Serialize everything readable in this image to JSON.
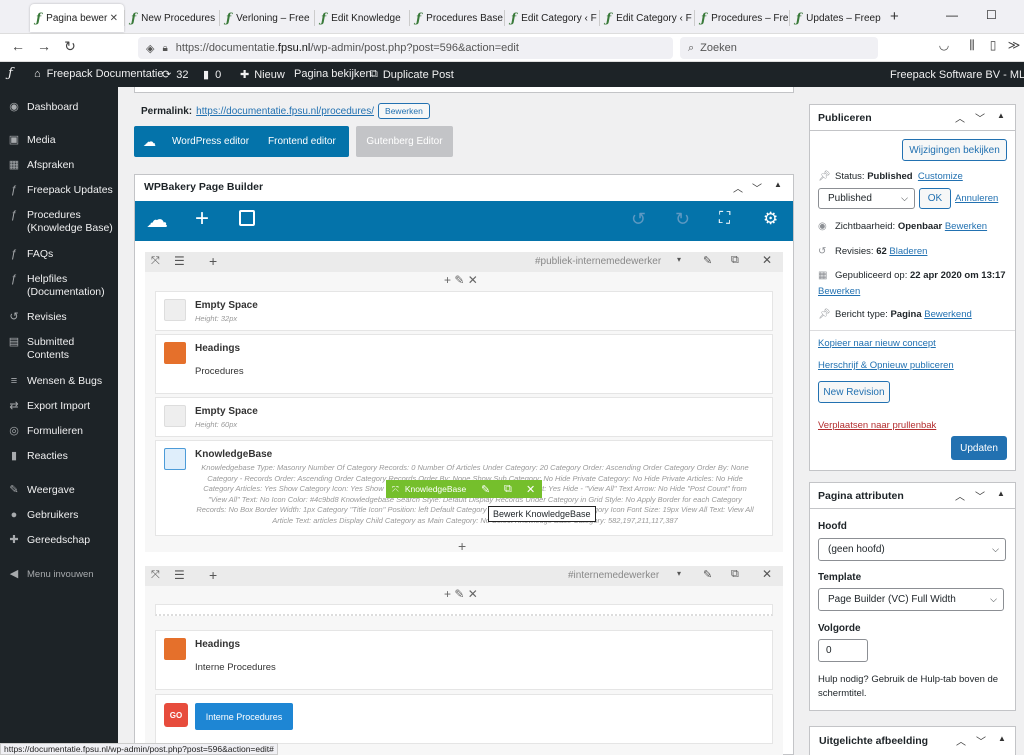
{
  "browser": {
    "tabs": [
      "Pagina bewer",
      "New Procedures",
      "Verloning – Free",
      "Edit Knowledge",
      "Procedures Base",
      "Edit Category ‹ F",
      "Edit Category ‹ F",
      "Procedures – Fre",
      "Updates – Freep"
    ],
    "new_tab": "+",
    "url_prefix": "https://documentatie.",
    "url_domain": "fpsu.nl",
    "url_path": "/wp-admin/post.php?post=596&action=edit",
    "search_placeholder": "Zoeken",
    "status_url": "https://documentatie.fpsu.nl/wp-admin/post.php?post=596&action=edit#"
  },
  "adminbar": {
    "site": "Freepack Documentatie",
    "updates": "32",
    "comments": "0",
    "new": "Nieuw",
    "view": "Pagina bekijken",
    "duplicate": "Duplicate Post",
    "account": "Freepack Software BV - ML"
  },
  "sidebar": {
    "items": [
      {
        "label": "Dashboard",
        "icon": "dashboard-icon",
        "glyph": "◉"
      },
      {
        "label": "Media",
        "icon": "media-icon",
        "glyph": "▣"
      },
      {
        "label": "Afspraken",
        "icon": "calendar-icon",
        "glyph": "▦"
      },
      {
        "label": "Freepack Updates",
        "icon": "freepack-icon",
        "glyph": "ƒ"
      },
      {
        "label": "Procedures\n(Knowledge Base)",
        "icon": "freepack-icon",
        "glyph": "ƒ"
      },
      {
        "label": "FAQs",
        "icon": "freepack-icon",
        "glyph": "ƒ"
      },
      {
        "label": "Helpfiles\n(Documentation)",
        "icon": "freepack-icon",
        "glyph": "ƒ"
      },
      {
        "label": "Revisies",
        "icon": "history-icon",
        "glyph": "↺"
      },
      {
        "label": "Submitted\nContents",
        "icon": "list-icon",
        "glyph": "▤"
      },
      {
        "label": "Wensen & Bugs",
        "icon": "list-icon",
        "glyph": "≡"
      },
      {
        "label": "Export Import",
        "icon": "export-icon",
        "glyph": "⇄"
      },
      {
        "label": "Formulieren",
        "icon": "forms-icon",
        "glyph": "◎"
      },
      {
        "label": "Reacties",
        "icon": "comments-icon",
        "glyph": "▮"
      },
      {
        "label": "Weergave",
        "icon": "appearance-icon",
        "glyph": "✎"
      },
      {
        "label": "Gebruikers",
        "icon": "users-icon",
        "glyph": "●"
      },
      {
        "label": "Gereedschap",
        "icon": "tools-icon",
        "glyph": "✚"
      },
      {
        "label": "Menu invouwen",
        "icon": "collapse-icon",
        "glyph": "◀"
      }
    ]
  },
  "permalink": {
    "label": "Permalink:",
    "url": "https://documentatie.fpsu.nl/procedures/",
    "edit": "Bewerken"
  },
  "editors": {
    "wp": "WordPress editor",
    "frontend": "Frontend editor",
    "gutenberg": "Gutenberg Editor"
  },
  "builder": {
    "title": "WPBakery Page Builder",
    "row1_id": "#publiek-internemedewerker",
    "row2_id": "#internemedewerker",
    "elements": [
      {
        "title": "Empty Space",
        "sub": "Height: 32px"
      },
      {
        "title": "Headings",
        "text": "Procedures"
      },
      {
        "title": "Empty Space",
        "sub": "Height: 60px"
      },
      {
        "title": "KnowledgeBase",
        "desc": "Knowledgebase Type: Masonry  Number Of Category Records: 0  Number Of Articles Under Category: 20  Category Order: Ascending Order  Category Order By: None  Category - Records Order: Ascending Order  Category Records Order By: None  Show Sub Category: No  Hide Private Category: No  Hide Private Articles: No  Hide Category Articles: Yes  Show Category Icon: Yes  Show Category Description': Yes  Show \"View All\" Text: Yes  Hide - \"View All\" Text Arrow: No  Hide \"Post Count\" from \"View All\" Text: No  Icon Color: #4c9bd8  Knowledgebase Search Style: Default  Display Records Under Category in Grid Style: No  Apply Border for each Category Records: No  Box Border Width: 1px  Category \"Title Icon\" Position: left  Default Category Icon Name: icon-briefcase  Category Icon Font Size: 19px  View All Text: View All  Article Text: articles  Display Child Category as Main Category: No  Select Knowledge Base Category: 582,197,211,117,387"
      },
      {
        "title": "Headings",
        "text": "Interne Procedures"
      }
    ],
    "toolbar_label": "KnowledgeBase",
    "tooltip": "Bewerk KnowledgeBase",
    "go_label": "GO",
    "button_label": "Interne Procedures"
  },
  "publish": {
    "title": "Publiceren",
    "preview": "Wijzigingen bekijken",
    "status_label": "Status:",
    "status": "Published",
    "customize": "Customize",
    "status_select": "Published",
    "ok": "OK",
    "cancel": "Annuleren",
    "visibility_label": "Zichtbaarheid:",
    "visibility": "Openbaar",
    "visibility_edit": "Bewerken",
    "revisions_label": "Revisies:",
    "revisions": "62",
    "browse": "Bladeren",
    "published_label": "Gepubliceerd op:",
    "published": "22 apr 2020 om 13:17",
    "published_edit": "Bewerken",
    "type_label": "Bericht type:",
    "type": "Pagina",
    "type_edit": "Bewerkend",
    "copy": "Kopieer naar nieuw concept",
    "rewrite": "Herschrijf & Opnieuw publiceren",
    "new_revision": "New Revision",
    "trash": "Verplaatsen naar prullenbak",
    "update": "Updaten"
  },
  "attributes": {
    "title": "Pagina attributen",
    "parent_label": "Hoofd",
    "parent": "(geen hoofd)",
    "template_label": "Template",
    "template": "Page Builder (VC) Full Width",
    "order_label": "Volgorde",
    "order": "0",
    "help": "Hulp nodig? Gebruik de Hulp-tab boven de schermtitel."
  },
  "featured": {
    "title": "Uitgelichte afbeelding"
  }
}
